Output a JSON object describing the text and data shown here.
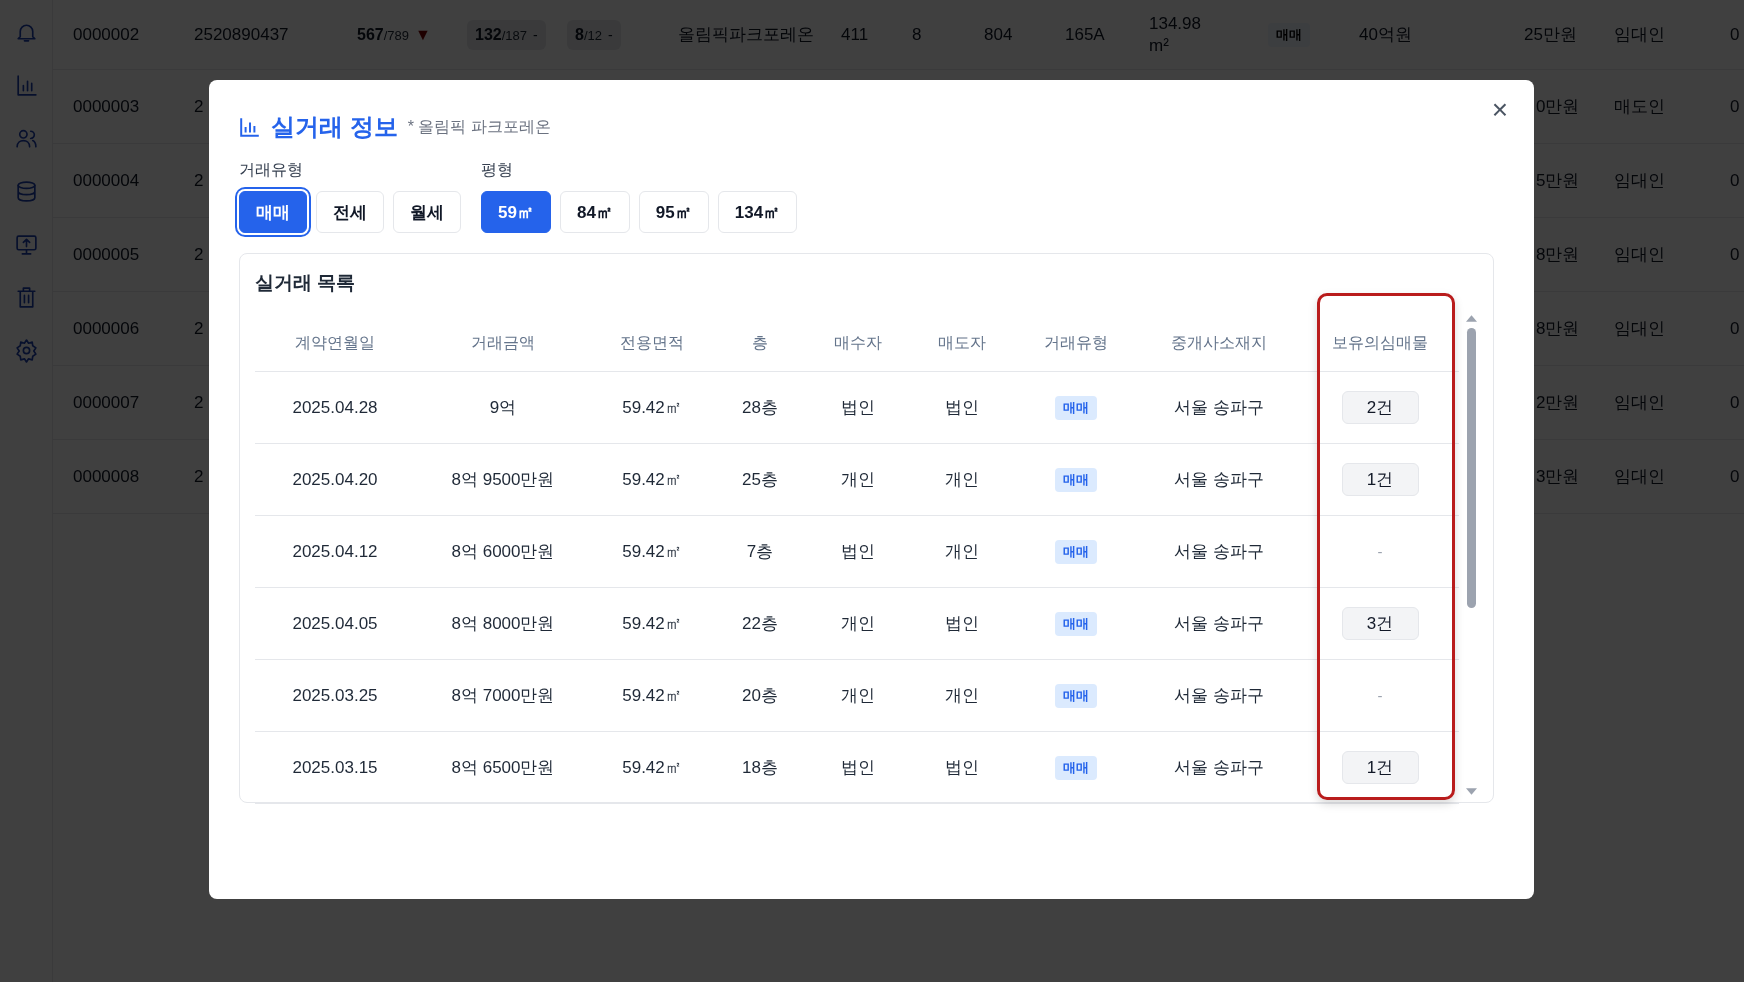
{
  "background_table": {
    "rows": [
      {
        "cells": [
          "0000002",
          "2520890437"
        ],
        "ratios": [
          {
            "value": "567",
            "total": "/789",
            "change": "▼",
            "falling": true
          },
          {
            "value": "132",
            "total": "/187",
            "change": "-",
            "falling": false
          },
          {
            "value": "8",
            "total": "/12",
            "change": "-",
            "falling": false
          }
        ],
        "rest": [
          "올림픽파크포레온",
          "411",
          "8",
          "804",
          "165A",
          "134.98 m²"
        ],
        "badge": "매매",
        "tail": [
          "40억원",
          "25만원",
          "임대인",
          "0"
        ]
      },
      {
        "cells": [
          "0000003",
          "2"
        ],
        "tail": [
          "0만원",
          "매도인",
          "0"
        ]
      },
      {
        "cells": [
          "0000004",
          "2"
        ],
        "tail": [
          "5만원",
          "임대인",
          "0"
        ]
      },
      {
        "cells": [
          "0000005",
          "2"
        ],
        "tail": [
          "8만원",
          "임대인",
          "0"
        ]
      },
      {
        "cells": [
          "0000006",
          "2"
        ],
        "tail": [
          "8만원",
          "임대인",
          "0"
        ]
      },
      {
        "cells": [
          "0000007",
          "2"
        ],
        "tail": [
          "2만원",
          "임대인",
          "0"
        ]
      },
      {
        "cells": [
          "0000008",
          "2"
        ],
        "tail": [
          "3만원",
          "임대인",
          "0"
        ]
      }
    ]
  },
  "modal": {
    "title": "실거래 정보",
    "subtitle": "* 올림픽 파크포레온",
    "close": "×",
    "filters": [
      {
        "label": "거래유형",
        "options": [
          {
            "label": "매매",
            "selected": true,
            "focused": true
          },
          {
            "label": "전세",
            "selected": false,
            "focused": false
          },
          {
            "label": "월세",
            "selected": false,
            "focused": false
          }
        ]
      },
      {
        "label": "평형",
        "options": [
          {
            "label": "59㎡",
            "selected": true,
            "focused": false
          },
          {
            "label": "84㎡",
            "selected": false,
            "focused": false
          },
          {
            "label": "95㎡",
            "selected": false,
            "focused": false
          },
          {
            "label": "134㎡",
            "selected": false,
            "focused": false
          }
        ]
      }
    ],
    "table": {
      "title": "실거래 목록",
      "last_column_highlighted": true,
      "columns": [
        "계약연월일",
        "거래금액",
        "전용면적",
        "층",
        "매수자",
        "매도자",
        "거래유형",
        "중개사소재지",
        "보유의심매물"
      ],
      "rows": [
        {
          "date": "2025.04.28",
          "price": "9억",
          "area": "59.42㎡",
          "floor": "28층",
          "buyer": "법인",
          "seller": "법인",
          "type": "매매",
          "office": "서울 송파구",
          "suspect": {
            "kind": "count",
            "text": "2건"
          }
        },
        {
          "date": "2025.04.20",
          "price": "8억 9500만원",
          "area": "59.42㎡",
          "floor": "25층",
          "buyer": "개인",
          "seller": "개인",
          "type": "매매",
          "office": "서울 송파구",
          "suspect": {
            "kind": "count",
            "text": "1건"
          }
        },
        {
          "date": "2025.04.12",
          "price": "8억 6000만원",
          "area": "59.42㎡",
          "floor": "7층",
          "buyer": "법인",
          "seller": "개인",
          "type": "매매",
          "office": "서울 송파구",
          "suspect": {
            "kind": "none",
            "text": "-"
          }
        },
        {
          "date": "2025.04.05",
          "price": "8억 8000만원",
          "area": "59.42㎡",
          "floor": "22층",
          "buyer": "개인",
          "seller": "법인",
          "type": "매매",
          "office": "서울 송파구",
          "suspect": {
            "kind": "count",
            "text": "3건"
          }
        },
        {
          "date": "2025.03.25",
          "price": "8억 7000만원",
          "area": "59.42㎡",
          "floor": "20층",
          "buyer": "개인",
          "seller": "개인",
          "type": "매매",
          "office": "서울 송파구",
          "suspect": {
            "kind": "none",
            "text": "-"
          }
        },
        {
          "date": "2025.03.15",
          "price": "8억 6500만원",
          "area": "59.42㎡",
          "floor": "18층",
          "buyer": "법인",
          "seller": "법인",
          "type": "매매",
          "office": "서울 송파구",
          "suspect": {
            "kind": "count",
            "text": "1건"
          }
        }
      ]
    }
  }
}
